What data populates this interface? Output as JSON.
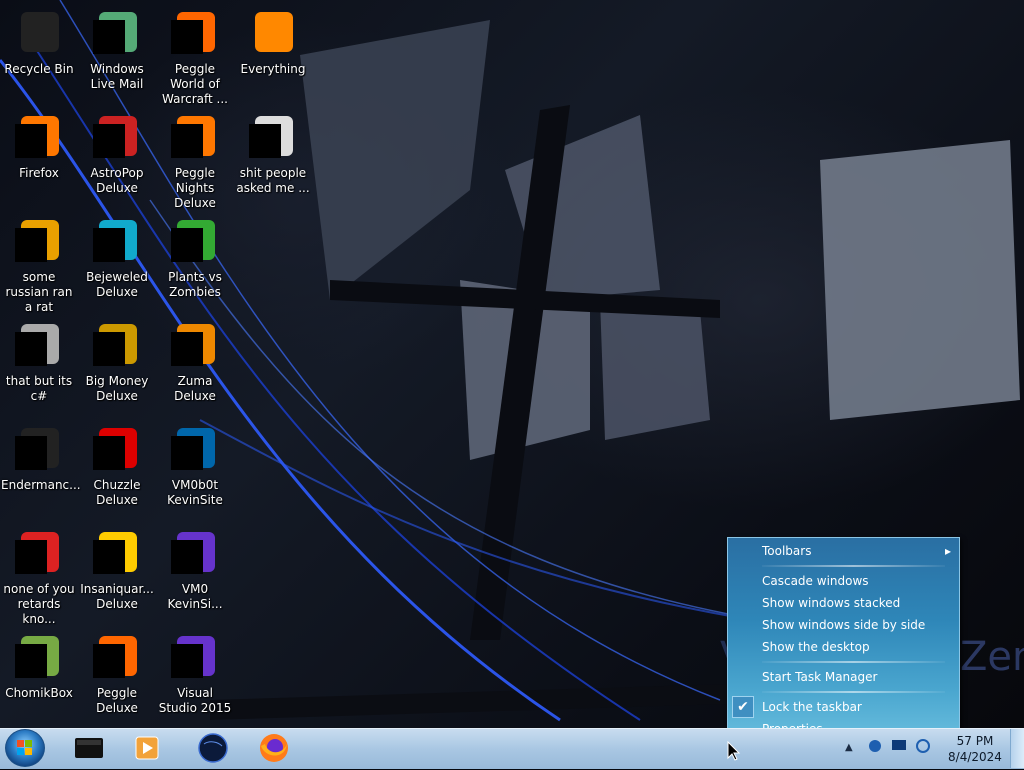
{
  "desktop": {
    "icons": [
      {
        "label": "Recycle Bin",
        "icon": "recycle-bin-icon"
      },
      {
        "label": "Windows Live Mail",
        "icon": "mail-icon"
      },
      {
        "label": "Peggle World of Warcraft ...",
        "icon": "peggle-icon"
      },
      {
        "label": "Everything",
        "icon": "everything-search-icon"
      },
      {
        "label": "Firefox",
        "icon": "firefox-icon"
      },
      {
        "label": "AstroPop Deluxe",
        "icon": "astropop-icon"
      },
      {
        "label": "Peggle Nights Deluxe",
        "icon": "peggle-nights-icon"
      },
      {
        "label": "shit people asked me ...",
        "icon": "folder-icon"
      },
      {
        "label": "some russian ran a rat",
        "icon": "file-e-icon"
      },
      {
        "label": "Bejeweled Deluxe",
        "icon": "bejeweled-icon"
      },
      {
        "label": "Plants vs Zombies",
        "icon": "plants-vs-zombies-icon"
      },
      {
        "label": "that but its c#",
        "icon": "windows-stack-icon"
      },
      {
        "label": "Big Money Deluxe",
        "icon": "big-money-icon"
      },
      {
        "label": "Zuma Deluxe",
        "icon": "zuma-icon"
      },
      {
        "label": "Endermanc...",
        "icon": "terminal-icon"
      },
      {
        "label": "Chuzzle Deluxe",
        "icon": "chuzzle-icon"
      },
      {
        "label": "VM0b0t KevinSite",
        "icon": "vm-shortcut-icon"
      },
      {
        "label": "none of you retards kno...",
        "icon": "chrome-like-icon"
      },
      {
        "label": "Insaniquar... Deluxe",
        "icon": "insaniquarium-icon"
      },
      {
        "label": "VM0 KevinSi...",
        "icon": "visual-studio-file-icon"
      },
      {
        "label": "ChomikBox",
        "icon": "chomikbox-icon"
      },
      {
        "label": "Peggle Deluxe",
        "icon": "peggle-deluxe-icon"
      },
      {
        "label": "Visual Studio 2015",
        "icon": "visual-studio-icon"
      }
    ]
  },
  "context_menu": {
    "items": {
      "toolbars": "Toolbars",
      "cascade": "Cascade windows",
      "stacked": "Show windows stacked",
      "side_by_side": "Show windows side by side",
      "show_desktop": "Show the desktop",
      "task_manager": "Start Task Manager",
      "lock_taskbar": "Lock the taskbar",
      "properties": "Properties"
    },
    "lock_checked": true,
    "submenu_arrow": "▸",
    "check_glyph": "✔"
  },
  "taskbar": {
    "start_icon": "windows-orb-icon",
    "pinned": [
      "media-icon",
      "media-player-icon",
      "globe-icon",
      "firefox-icon"
    ],
    "clock_time": "57 PM",
    "clock_date": "8/4/2024"
  },
  "colors": {
    "menu_top": "#2a6fa3",
    "menu_bottom": "#69bede",
    "taskbar": "#a9c7e3"
  }
}
